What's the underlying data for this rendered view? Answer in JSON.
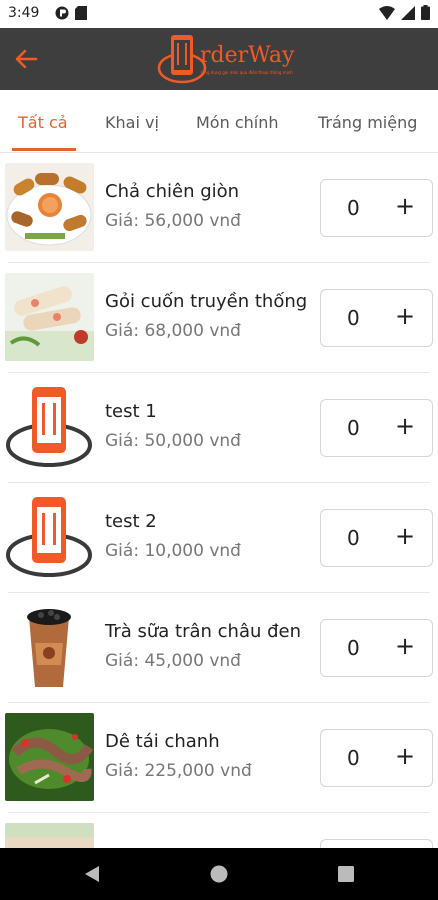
{
  "status_bar": {
    "time": "3:49"
  },
  "app_bar": {
    "brand": "rderWay",
    "tagline": "Ứng dụng gọi món qua điện thoại thông minh"
  },
  "tabs": [
    {
      "label": "Tất cả",
      "active": true
    },
    {
      "label": "Khai vị",
      "active": false
    },
    {
      "label": "Món chính",
      "active": false
    },
    {
      "label": "Tráng miệng",
      "active": false
    }
  ],
  "items": [
    {
      "name": "Chả chiên giòn",
      "price": "Giá: 56,000 vnđ",
      "qty": "0",
      "plus": "+",
      "image": "spring-rolls-photo"
    },
    {
      "name": "Gỏi cuốn truyền thống",
      "price": "Giá: 68,000 vnđ",
      "qty": "0",
      "plus": "+",
      "image": "fresh-rolls-photo"
    },
    {
      "name": "test 1",
      "price": "Giá: 50,000 vnđ",
      "qty": "0",
      "plus": "+",
      "image": "placeholder-logo"
    },
    {
      "name": "test 2",
      "price": "Giá: 10,000 vnđ",
      "qty": "0",
      "plus": "+",
      "image": "placeholder-logo"
    },
    {
      "name": "Trà sữa trân châu đen",
      "price": "Giá: 45,000 vnđ",
      "qty": "0",
      "plus": "+",
      "image": "bubble-tea-photo"
    },
    {
      "name": "Dê tái chanh",
      "price": "Giá: 225,000 vnđ",
      "qty": "0",
      "plus": "+",
      "image": "goat-salad-photo"
    }
  ],
  "colors": {
    "accent": "#e8622c",
    "appbar": "#3e3e3e",
    "navbar": "#000000"
  }
}
